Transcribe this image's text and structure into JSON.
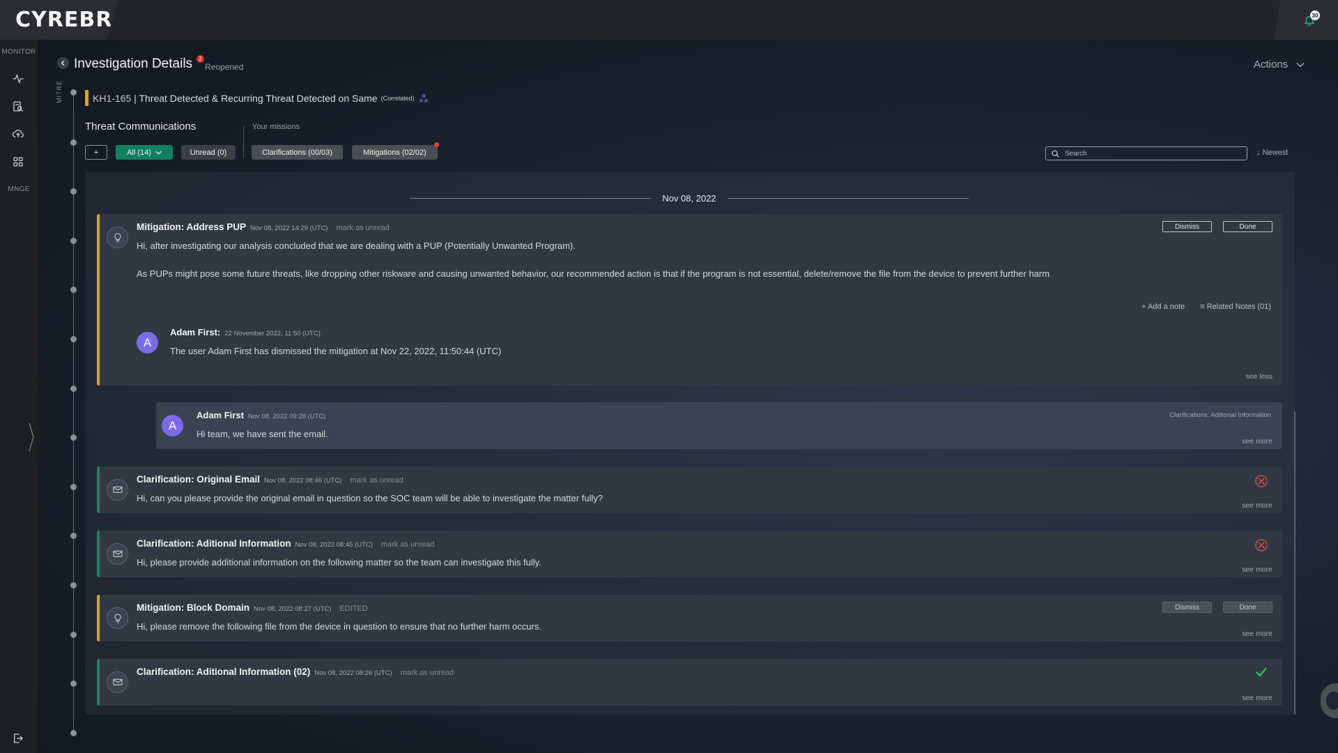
{
  "brand": {
    "logo": "CYREBRO"
  },
  "topbar": {
    "notification_count": "30"
  },
  "nav": {
    "monitor_label": "MONITOR",
    "manage_label": "MNGE",
    "icons": [
      "activity-icon",
      "file-search-icon",
      "cloud-upload-icon",
      "grid-icon"
    ]
  },
  "header": {
    "title": "Investigation Details",
    "badge": "2",
    "status": "Reopened",
    "actions_label": "Actions"
  },
  "timeline": {
    "mitre_label": "MITRE"
  },
  "incident": {
    "id": "KH1-165",
    "separator": " | ",
    "title": "Threat Detected & Recurring Threat Detected on Same",
    "tag": "(Correlated)"
  },
  "comms": {
    "title": "Threat Communications",
    "missions_title": "Your missions",
    "add_label": "+",
    "all_label": "All (14)",
    "unread_label": "Unread (0)",
    "clarifications_label": "Clarifications (00/03)",
    "mitigations_label": "Mitigations (02/02)",
    "search_placeholder": "Search",
    "sort_label": "Newest"
  },
  "feed": {
    "date": "Nov 08, 2022",
    "cards": [
      {
        "title": "Mitigation: Address PUP",
        "meta": "Nov 08, 2022 14:29 (UTC)",
        "extra": "mark as unread",
        "body1": "Hi, after investigating our analysis concluded that we are dealing with a PUP (Potentially Unwanted Program).",
        "body2": "As PUPs might pose some future threats, like dropping other riskware and causing unwanted behavior, our recommended action is that if the program is not essential, delete/remove the file from the device to prevent further harm",
        "dismiss": "Dismiss",
        "done": "Done",
        "add_note": "+ Add a note",
        "related_notes": "Related Notes (01)",
        "note_avatar": "A",
        "note_author": "Adam First:",
        "note_meta": "22 November 2022, 11:50 (UTC)",
        "note_body": "The user Adam First has dismissed the mitigation at Nov 22, 2022, 11:50:44 (UTC)",
        "see": "see less"
      },
      {
        "avatar": "A",
        "author": "Adam First",
        "meta": "Nov 08, 2022 09:28 (UTC)",
        "tag": "Clarifications: Aditional Information",
        "body": "Hi team, we have sent the email.",
        "see": "see more"
      },
      {
        "title": "Clarification: Original Email",
        "meta": "Nov 08, 2022 08:46 (UTC)",
        "extra": "mark as unread",
        "body": "Hi, can you please provide the original email in question so the SOC team will be able to investigate the matter fully?",
        "see": "see more"
      },
      {
        "title": "Clarification: Aditional Information",
        "meta": "Nov 08, 2022 08:45 (UTC)",
        "extra": "mark as unread",
        "body": "Hi, please provide additional information on the following matter so the team can investigate this fully.",
        "see": "see more"
      },
      {
        "title": "Mitigation: Block Domain",
        "meta": "Nov 08, 2022 08:27 (UTC)",
        "extra": "EDITED",
        "body": "Hi, please remove the following file from the device in question to ensure that no further harm occurs.",
        "dismiss": "Dismiss",
        "done": "Done",
        "see": "see more"
      },
      {
        "title": "Clarification: Aditional Information (02)",
        "meta": "Nov 08, 2022 08:26 (UTC)",
        "extra": "mark as unread",
        "see": "see more"
      }
    ]
  },
  "colors": {
    "mitigation_accent": "#e0a417",
    "clarification_accent": "#12876a",
    "all_chip": "#11805e",
    "avatar": "#7b6be8"
  }
}
